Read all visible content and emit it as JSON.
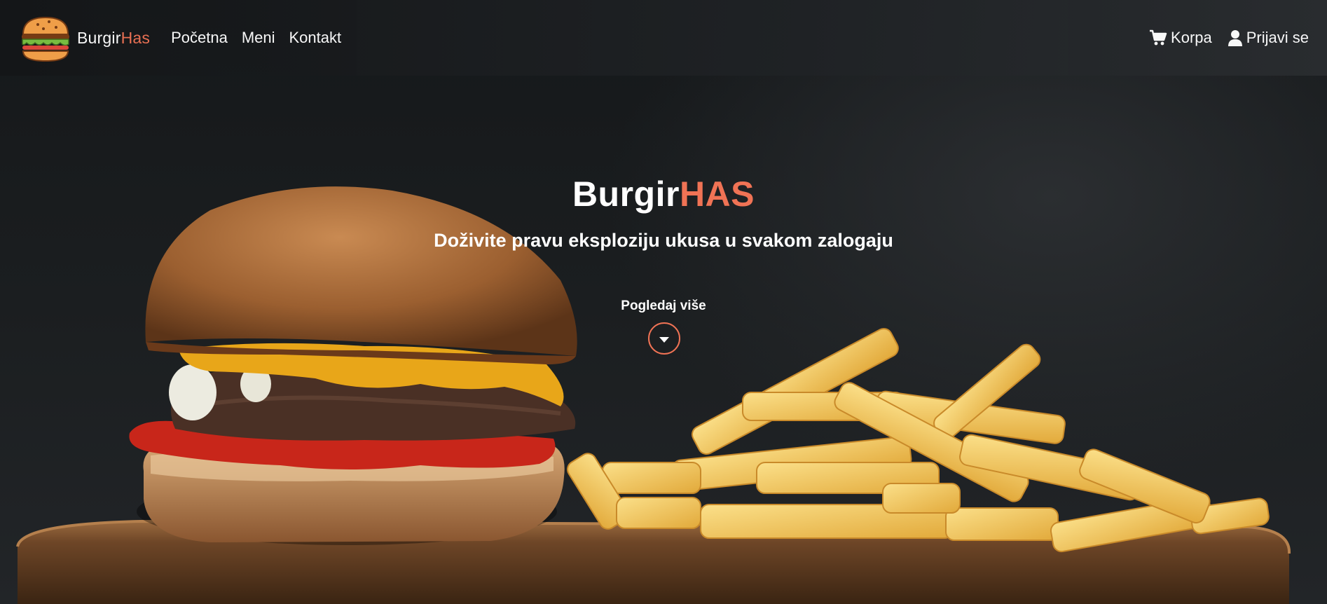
{
  "nav": {
    "brand_main": "Burgir",
    "brand_accent": "Has",
    "links": [
      "Početna",
      "Meni",
      "Kontakt"
    ],
    "cart_label": "Korpa",
    "login_label": "Prijavi se"
  },
  "hero": {
    "title_main": "Burgir",
    "title_accent": "HAS",
    "subtitle": "Doživite pravu eksploziju ukusa u svakom zalogaju",
    "more_label": "Pogledaj više"
  },
  "colors": {
    "accent": "#f07355",
    "nav_bg": "#1c1f21",
    "text": "#ffffff"
  },
  "icons": {
    "logo": "burger-logo-icon",
    "cart": "cart-icon",
    "user": "user-icon",
    "more": "chevron-down-icon"
  }
}
